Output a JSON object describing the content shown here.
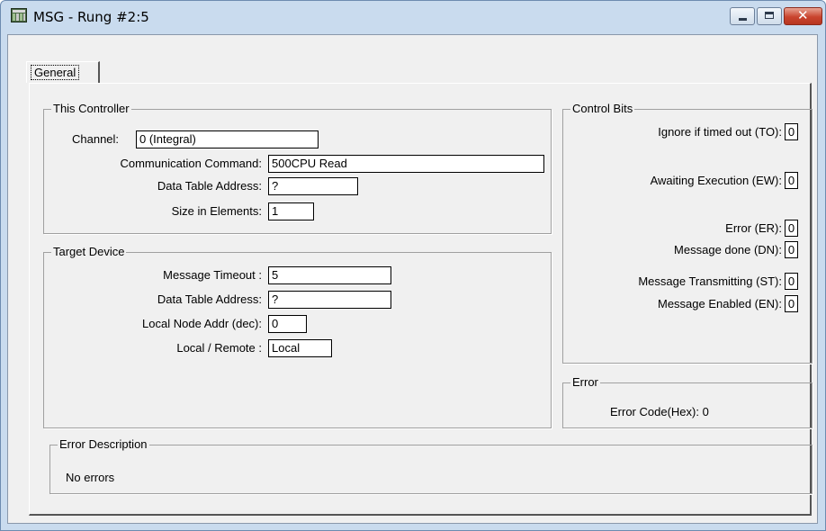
{
  "window": {
    "title": "MSG - Rung #2:5",
    "app_icon": "plc-icon",
    "controls": {
      "minimize": "minimize-icon",
      "maximize": "maximize-icon",
      "close": "close-icon",
      "close_glyph": "✕"
    }
  },
  "tabs": [
    {
      "label": "General",
      "selected": true
    }
  ],
  "this_controller": {
    "title": "This Controller",
    "channel_label": "Channel:",
    "channel_value": "0 (Integral)",
    "comm_command_label": "Communication Command:",
    "comm_command_value": "500CPU Read",
    "data_table_address_label": "Data Table Address:",
    "data_table_address_value": "?",
    "size_label": "Size in Elements:",
    "size_value": "1"
  },
  "target_device": {
    "title": "Target Device",
    "timeout_label": "Message Timeout :",
    "timeout_value": "5",
    "data_table_address_label": "Data Table Address:",
    "data_table_address_value": "?",
    "local_node_label": "Local Node Addr (dec):",
    "local_node_value": "0",
    "local_remote_label": "Local / Remote :",
    "local_remote_value": "Local"
  },
  "control_bits": {
    "title": "Control Bits",
    "bits": [
      {
        "label": "Ignore if timed out (TO):",
        "value": "0"
      },
      {
        "label": "Awaiting Execution (EW):",
        "value": "0"
      },
      {
        "label": "Error (ER):",
        "value": "0"
      },
      {
        "label": "Message done (DN):",
        "value": "0"
      },
      {
        "label": "Message Transmitting (ST):",
        "value": "0"
      },
      {
        "label": "Message Enabled (EN):",
        "value": "0"
      }
    ]
  },
  "error": {
    "title": "Error",
    "code_label": "Error Code(Hex): 0"
  },
  "error_description": {
    "title": "Error Description",
    "text": "No errors"
  },
  "colors": {
    "chrome": "#c9dbee",
    "panel": "#f0f0f0",
    "close_button": "#c9442e"
  }
}
